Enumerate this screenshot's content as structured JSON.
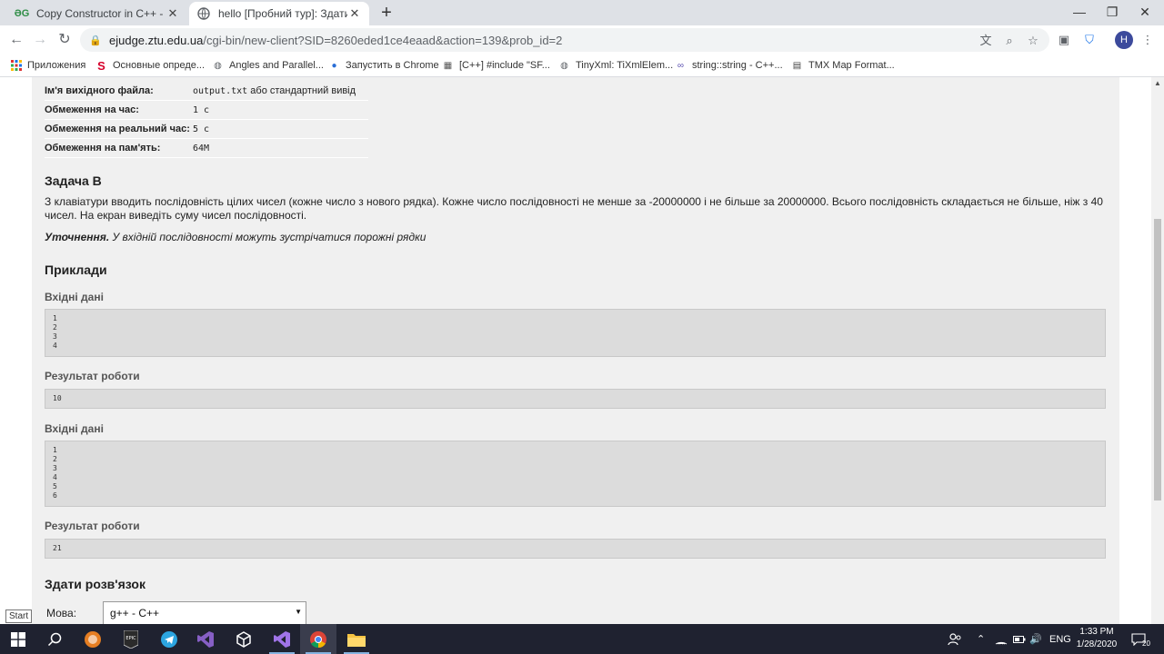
{
  "browser": {
    "tabs": [
      {
        "title": "Copy Constructor in C++ - GeeksforGeeks",
        "active": false,
        "favicon": "geeksforgeeks-icon"
      },
      {
        "title": "hello [Пробний тур]: Здати розв'язок",
        "active": true,
        "favicon": "globe-icon"
      }
    ],
    "url": {
      "host": "ejudge.ztu.edu.ua",
      "path": "/cgi-bin/new-client?SID=8260eded1ce4eaad&action=139&prob_id=2"
    },
    "profile_initial": "H",
    "bookmarks": [
      {
        "label": "Приложения",
        "icon": "apps-grid-icon"
      },
      {
        "label": "Основные опреде...",
        "icon": "s-logo-icon"
      },
      {
        "label": "Angles and Parallel...",
        "icon": "globe-icon"
      },
      {
        "label": "Запустить в Chrome",
        "icon": "planet-icon"
      },
      {
        "label": "[C++] #include \"SF...",
        "icon": "code-icon"
      },
      {
        "label": "TinyXml: TiXmlElem...",
        "icon": "globe-icon"
      },
      {
        "label": "string::string - C++...",
        "icon": "cplusplus-icon"
      },
      {
        "label": "TMX Map Format...",
        "icon": "doc-icon"
      }
    ]
  },
  "problem": {
    "info": [
      {
        "label": "Ім'я вихідного файла:",
        "value_mono": "output.txt",
        "value_text": " або стандартний вивід"
      },
      {
        "label": "Обмеження на час:",
        "value_mono": "1 с",
        "value_text": ""
      },
      {
        "label": "Обмеження на реальний час:",
        "value_mono": "5 с",
        "value_text": ""
      },
      {
        "label": "Обмеження на пам'ять:",
        "value_mono": "64M",
        "value_text": ""
      }
    ],
    "title": "Задача B",
    "statement": "З клавіатури вводить послідовність цілих чисел (кожне число з нового рядка). Кожне число послідовності не менше за -20000000 і не більше за 20000000. Всього послідовність складається не більше, ніж з 40 чисел. На екран виведіть суму чисел послідовності.",
    "note_label": "Уточнення.",
    "note_text": " У вхідній послідовності можуть зустрічатися порожні рядки",
    "examples_title": "Приклади",
    "input_label": "Вхідні дані",
    "output_label": "Результат роботи",
    "examples": [
      {
        "input": [
          "1",
          "2",
          "3",
          "4"
        ],
        "output": "10"
      },
      {
        "input": [
          "1",
          "2",
          "3",
          "4",
          "5",
          "6"
        ],
        "output": "21"
      }
    ],
    "submit_title": "Здати розв'язок",
    "language_label": "Мова:",
    "language_value": "g++ - C++"
  },
  "tooltip": "Start",
  "taskbar": {
    "language": "ENG",
    "time": "1:33 PM",
    "date": "1/28/2020",
    "notification_count": "20"
  }
}
